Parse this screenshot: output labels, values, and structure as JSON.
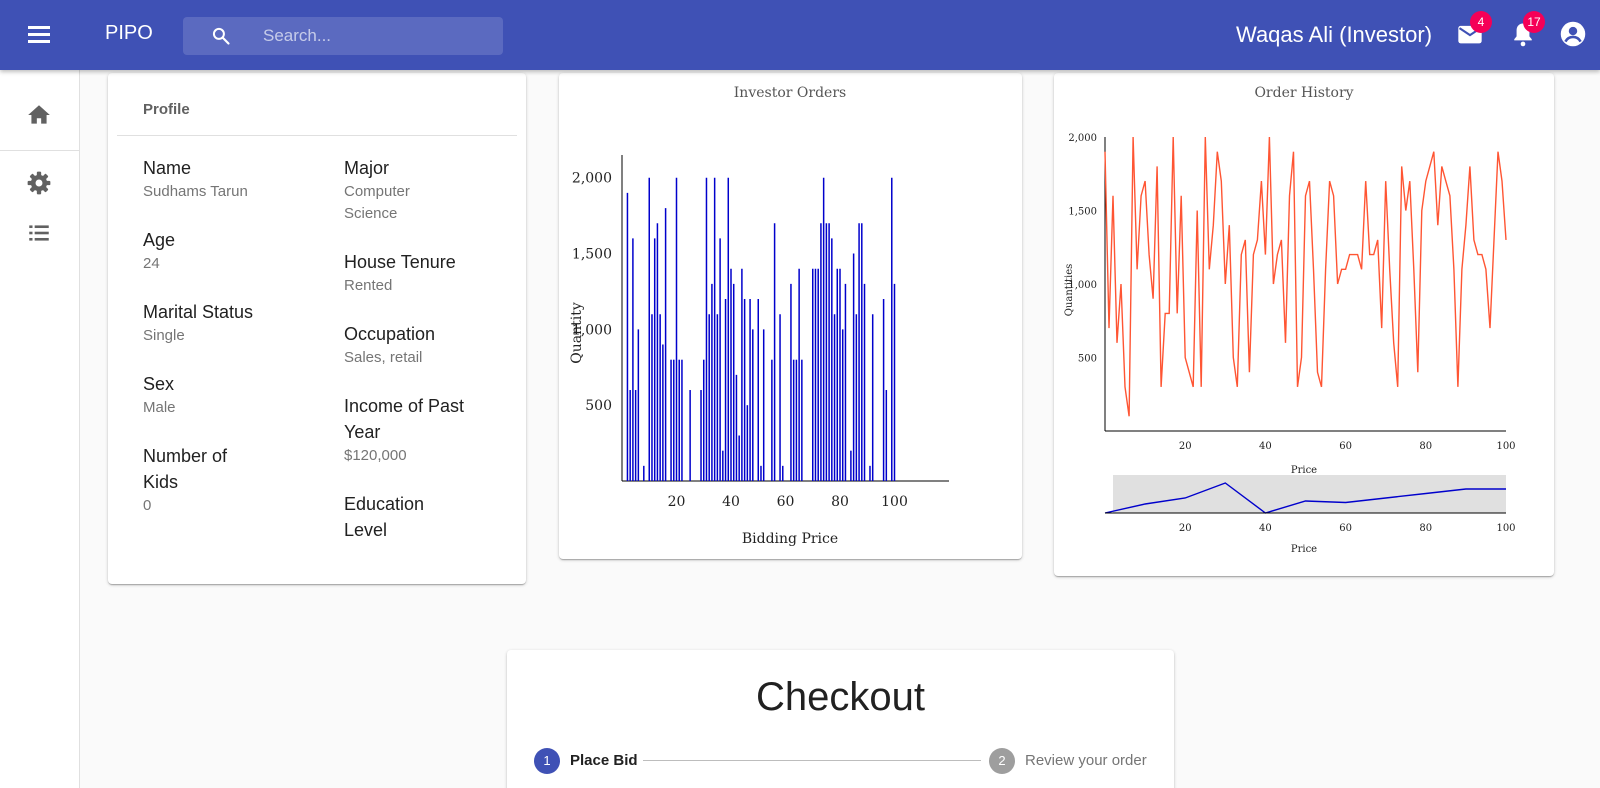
{
  "appbar": {
    "brand": "PIPO",
    "search_placeholder": "Search...",
    "user": "Waqas Ali (Investor)",
    "mail_badge": "4",
    "notifications_badge": "17"
  },
  "colors": {
    "primary": "#3f51b5",
    "badge": "#f50057",
    "bar_series": "#0000cc",
    "line_series": "#ff5533",
    "brush_series": "#0000cc"
  },
  "drawer": {
    "items": [
      "home-icon",
      "gear-icon",
      "list-icon"
    ]
  },
  "profile": {
    "title": "Profile",
    "left_fields": [
      {
        "label": "Name",
        "value": "Sudhams Tarun"
      },
      {
        "label": "Age",
        "value": "24"
      },
      {
        "label": "Marital Status",
        "value": "Single"
      },
      {
        "label": "Sex",
        "value": "Male"
      },
      {
        "label": "Number of Kids",
        "value": "0"
      }
    ],
    "right_fields": [
      {
        "label": "Major",
        "value": "Computer Science"
      },
      {
        "label": "House Tenure",
        "value": "Rented"
      },
      {
        "label": "Occupation",
        "value": "Sales, retail"
      },
      {
        "label": "Income of Past Year",
        "value": "$120,000"
      },
      {
        "label": "Education Level",
        "value": ""
      }
    ]
  },
  "chart_data": [
    {
      "type": "bar",
      "title": "Investor Orders",
      "xlabel": "Bidding Price",
      "ylabel": "Quantity",
      "xlim": [
        0,
        120
      ],
      "ylim": [
        0,
        2150
      ],
      "xticks": [
        20,
        40,
        60,
        80,
        100
      ],
      "yticks": [
        500,
        1000,
        1500,
        2000
      ],
      "ytick_labels": [
        "500",
        "1,000",
        "1,500",
        "2,000"
      ],
      "x": [
        2,
        3,
        4,
        5,
        6,
        8,
        10,
        11,
        12,
        13,
        14,
        15,
        16,
        18,
        19,
        20,
        21,
        22,
        25,
        29,
        30,
        31,
        32,
        33,
        34,
        35,
        36,
        37,
        38,
        39,
        40,
        41,
        42,
        43,
        44,
        45,
        46,
        47,
        48,
        50,
        51,
        52,
        55,
        56,
        58,
        59,
        62,
        63,
        64,
        65,
        66,
        70,
        71,
        72,
        73,
        74,
        75,
        76,
        77,
        78,
        79,
        80,
        81,
        82,
        84,
        85,
        86,
        87,
        88,
        89,
        91,
        92,
        96,
        97,
        99,
        100
      ],
      "values": [
        1900,
        600,
        1600,
        600,
        1000,
        100,
        2000,
        1100,
        1600,
        1700,
        1100,
        900,
        1800,
        800,
        800,
        2000,
        800,
        800,
        600,
        600,
        800,
        2000,
        1100,
        1300,
        2000,
        1100,
        1600,
        200,
        1200,
        2000,
        1400,
        1300,
        700,
        300,
        1400,
        1200,
        500,
        1200,
        1000,
        1200,
        100,
        1000,
        800,
        1700,
        1100,
        100,
        1300,
        800,
        800,
        1400,
        800,
        1400,
        1400,
        1400,
        1700,
        2000,
        1700,
        1700,
        1600,
        1100,
        1400,
        1400,
        1000,
        1300,
        200,
        1500,
        1100,
        1700,
        1700,
        1300,
        100,
        1100,
        1200,
        600,
        2000,
        1300
      ]
    },
    {
      "type": "line",
      "title": "Order History",
      "xlabel": "Price",
      "ylabel": "Quantities",
      "xlim": [
        0,
        100
      ],
      "ylim": [
        0,
        2000
      ],
      "xticks": [
        20,
        40,
        60,
        80,
        100
      ],
      "yticks": [
        500,
        1000,
        1500,
        2000
      ],
      "ytick_labels": [
        "500",
        "1,000",
        "1,500",
        "2,000"
      ],
      "x": [
        0,
        1,
        2,
        3,
        4,
        5,
        6,
        7,
        8,
        9,
        10,
        11,
        12,
        13,
        14,
        15,
        16,
        17,
        18,
        19,
        20,
        21,
        22,
        23,
        24,
        25,
        26,
        27,
        28,
        29,
        30,
        31,
        32,
        33,
        34,
        35,
        36,
        37,
        38,
        39,
        40,
        41,
        42,
        43,
        44,
        45,
        46,
        47,
        48,
        49,
        50,
        51,
        52,
        53,
        54,
        55,
        56,
        57,
        58,
        59,
        60,
        61,
        62,
        63,
        64,
        65,
        66,
        67,
        68,
        69,
        70,
        71,
        72,
        73,
        74,
        75,
        76,
        77,
        78,
        79,
        80,
        81,
        82,
        83,
        84,
        85,
        86,
        87,
        88,
        89,
        90,
        91,
        92,
        93,
        94,
        95,
        96,
        97,
        98,
        99,
        100
      ],
      "values": [
        1900,
        700,
        1600,
        600,
        1000,
        300,
        100,
        2000,
        1100,
        1600,
        1700,
        1200,
        900,
        1800,
        300,
        800,
        800,
        2000,
        800,
        1600,
        500,
        400,
        300,
        1500,
        300,
        2000,
        1100,
        1400,
        1900,
        1700,
        1000,
        1400,
        500,
        300,
        1200,
        1300,
        400,
        1200,
        1300,
        1700,
        1200,
        2000,
        1000,
        1200,
        1300,
        600,
        1600,
        1900,
        300,
        500,
        1600,
        1700,
        1100,
        400,
        300,
        1100,
        1700,
        1600,
        1000,
        1100,
        1100,
        1200,
        1200,
        1200,
        1100,
        1700,
        1200,
        1200,
        1300,
        700,
        1700,
        1100,
        600,
        300,
        1800,
        1500,
        1700,
        1100,
        400,
        1500,
        1700,
        1800,
        1900,
        1400,
        1800,
        1700,
        1600,
        1100,
        300,
        1100,
        1400,
        1800,
        1300,
        1200,
        1200,
        1100,
        700,
        1300,
        1900,
        1700,
        1300
      ]
    },
    {
      "type": "line",
      "title": "",
      "xlabel": "Price",
      "xlim": [
        0,
        100
      ],
      "xticks": [
        20,
        40,
        60,
        80,
        100
      ],
      "x": [
        0,
        10,
        20,
        30,
        40,
        50,
        60,
        70,
        80,
        90,
        100
      ],
      "values": [
        0,
        30,
        50,
        100,
        0,
        40,
        35,
        50,
        65,
        80,
        80
      ]
    }
  ],
  "checkout": {
    "title": "Checkout",
    "steps": [
      {
        "number": "1",
        "label": "Place Bid"
      },
      {
        "number": "2",
        "label": "Review your order"
      }
    ]
  }
}
